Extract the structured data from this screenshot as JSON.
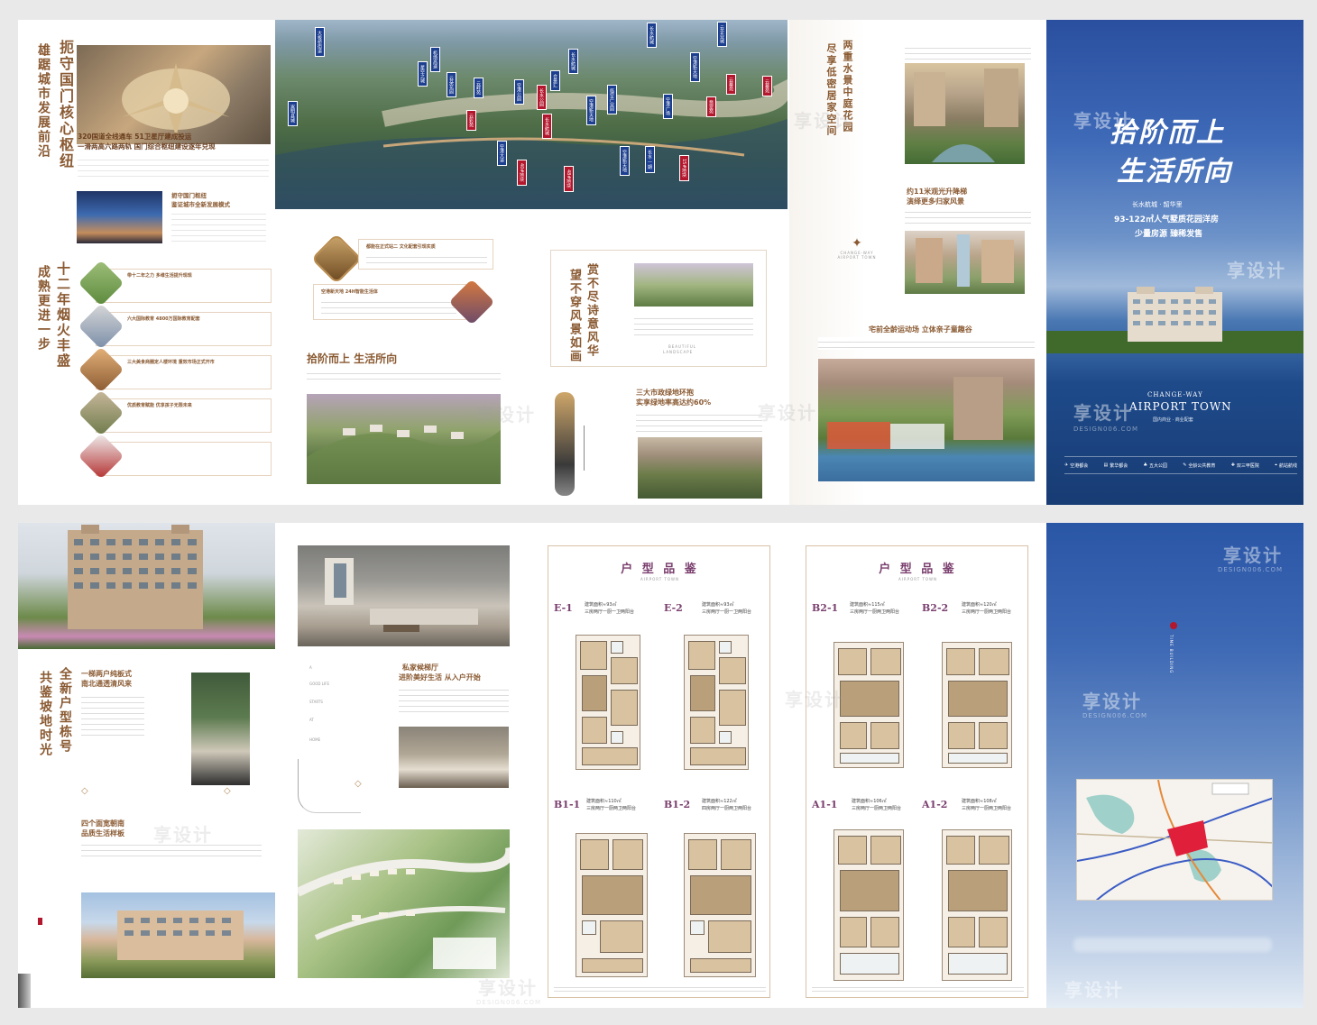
{
  "top": {
    "left_panel": {
      "title_v1": "扼守国门核心枢纽",
      "title_v2": "雄踞城市发展前沿",
      "headline1": "320国道全线通车 51卫星厅建成投运",
      "headline2": "一滑两高六路两轨 国门综合枢纽建设逐年兑现",
      "sub_title1": "扼守国门枢纽",
      "sub_title2": "鉴证城市全新发展模式",
      "title_v3": "十二年烟火丰盛",
      "title_v4": "成熟更进一步",
      "items": [
        "带十二年之力 多维生活提升现现",
        "六大国际教育 4800万国际教育配套",
        "三大美食商圈定人楼环境 重效市场正式开市",
        "优质教育赋能 优享孩子无限未来"
      ]
    },
    "aerial_tags_blue": [
      "大板桥街道",
      "嵩明县城",
      "机场高速",
      "星空之城",
      "云朵花园",
      "合景汇",
      "云畔苑",
      "长水航城",
      "合景汇",
      "空港公园",
      "空港新天地",
      "临空产业园",
      "空港广场",
      "空港新天地",
      "空港新天地",
      "长水·一期",
      "长水航城"
    ],
    "aerial_tags_red": [
      "长水航城",
      "云彩苑",
      "长水公园",
      "翡翠苑",
      "云幕苑",
      "云幕苑"
    ],
    "aerial_labels": [
      "空港大道",
      "40#地块",
      "48#地块",
      "15#地块",
      "云企业城"
    ],
    "mid": {
      "t1": "都能在正式站二 文化配套引现实质",
      "t2": "空港新天地 24H智能生活体",
      "title": "拾阶而上 生活所向",
      "v_title1": "赏不尽诗意风华",
      "v_title2": "望不穿风景如画",
      "landscape_en1": "BEAUTIFUL",
      "landscape_en2": "LANDSCAPE",
      "tag3": "三大市政绿地环抱",
      "tag4": "实享绿地率高达约60%"
    },
    "right_inner": {
      "v1": "两重水景中庭花园",
      "v2": "尽享低密居家空间",
      "h1": "约11米观光升降梯",
      "h2": "演绎更多归家风景",
      "h3": "宅前全龄运动场 立体亲子童趣谷",
      "logo_en1": "CHANGE-WAY",
      "logo_en2": "AIRPORT TOWN"
    },
    "cover": {
      "title1": "拾阶而上",
      "title2": "生活所向",
      "brand": "长水航城 · 韶华里",
      "area": "93-122㎡人气墅质花园洋房",
      "slogan": "少量房源 臻稀发售",
      "en1": "CHANGE-WAY",
      "en2": "AIRPORT TOWN",
      "en_sub": "国内商业 · 商业配套",
      "icons": [
        "空港都会",
        "繁华都会",
        "五大公园",
        "全龄公共教育",
        "双三甲医院",
        "航站航线"
      ]
    }
  },
  "bottom": {
    "panel1": {
      "v1": "全新户型栋号",
      "v2": "共鉴坡地时光",
      "h1": "一梯两户纯板式",
      "h2": "南北通透清风来",
      "h3": "四个面宽朝南",
      "h4": "品质生活样板"
    },
    "panel2": {
      "h1": "私家候梯厅",
      "h2": "进阶美好生活 从入户开始",
      "left_en1": "A",
      "left_en2": "GOOD LIFE",
      "left_en3": "STARTS",
      "left_en4": "AT",
      "left_en5": "HOME"
    },
    "fp1": {
      "title": "户 型 品 鉴",
      "sub": "AIRPORT TOWN",
      "units": [
        {
          "code": "E-1",
          "tag": "户型",
          "spec1": "建筑面积≈93㎡",
          "spec2": "三房两厅一厨一卫两阳台"
        },
        {
          "code": "E-2",
          "tag": "户型",
          "spec1": "建筑面积≈93㎡",
          "spec2": "三房两厅一厨一卫两阳台"
        },
        {
          "code": "B1-1",
          "tag": "户型",
          "spec1": "建筑面积≈110㎡",
          "spec2": "三房两厅一厨两卫两阳台"
        },
        {
          "code": "B1-2",
          "tag": "户型",
          "spec1": "建筑面积≈122㎡",
          "spec2": "四房两厅一厨两卫两阳台"
        }
      ]
    },
    "fp2": {
      "title": "户 型 品 鉴",
      "sub": "AIRPORT TOWN",
      "units": [
        {
          "code": "B2-1",
          "tag": "户型",
          "spec1": "建筑面积≈115㎡",
          "spec2": "三房两厅一厨两卫两阳台"
        },
        {
          "code": "B2-2",
          "tag": "户型",
          "spec1": "建筑面积≈120㎡",
          "spec2": "三房两厅一厨两卫两阳台"
        },
        {
          "code": "A1-1",
          "tag": "户型",
          "spec1": "建筑面积≈106㎡",
          "spec2": "三房两厅一厨两卫两阳台"
        },
        {
          "code": "A1-2",
          "tag": "户型",
          "spec1": "建筑面积≈108㎡",
          "spec2": "三房两厅一厨两卫两阳台"
        }
      ]
    },
    "back": {
      "vertical_en": "TIME BUILDING"
    }
  },
  "watermark": {
    "cn": "享设计",
    "en": "DESIGN006.COM"
  },
  "colors": {
    "gold": "#a8703c",
    "brown": "#8a5a32",
    "cover_blue": "#2c57a8",
    "tag_blue": "#1d3f8f",
    "tag_red": "#b3172d",
    "purple": "#7a3f6e"
  }
}
